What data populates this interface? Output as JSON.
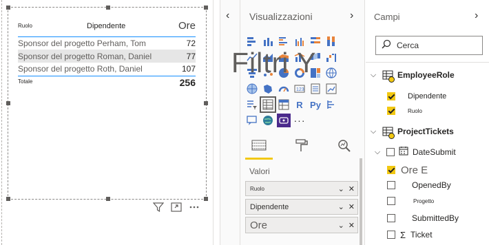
{
  "table_visual": {
    "headers": {
      "role": "Ruolo",
      "employee": "Dipendente",
      "hours": "Ore"
    },
    "rows": [
      {
        "label": "Sponsor del progetto Perham, Tom",
        "value": "72"
      },
      {
        "label": "Sponsor del progetto Roman, Daniel",
        "value": "77"
      },
      {
        "label": "Sponsor del progetto Roth, Daniel",
        "value": "107"
      }
    ],
    "total": {
      "label": "Totale",
      "value": "256"
    },
    "toolbar_icons": [
      "filter-icon",
      "focus-mode-icon",
      "more-options-icon"
    ]
  },
  "viz_pane": {
    "title": "Visualizzazioni",
    "overlay_text": "Filtri Y",
    "more": "···",
    "tabs": [
      "fields-tab-icon",
      "format-tab-icon",
      "analytics-tab-icon"
    ],
    "values_label": "Valori",
    "wells": [
      "Ruolo",
      "Dipendente",
      "Ore"
    ]
  },
  "fields_pane": {
    "title": "Campi",
    "search_placeholder": "Cerca",
    "tables": [
      {
        "name": "EmployeeRole",
        "fields": [
          {
            "name": "Dipendente",
            "checked": true
          },
          {
            "name": "Ruolo",
            "checked": true
          }
        ]
      },
      {
        "name": "ProjectTickets",
        "fields": [
          {
            "name": "DateSubmit",
            "checked": false
          },
          {
            "name": "Ore E",
            "checked": true
          },
          {
            "name": "OpenedBy",
            "checked": false
          },
          {
            "name": "Progetto",
            "checked": false
          },
          {
            "name": "SubmittedBy",
            "checked": false
          },
          {
            "name": "Ticket",
            "checked": false
          }
        ]
      }
    ]
  },
  "colors": {
    "accent_yellow": "#f2c811",
    "table_line_blue": "#118dff",
    "row_shade": "#e6e6e6",
    "purple_visual": "#4b2a8c"
  }
}
